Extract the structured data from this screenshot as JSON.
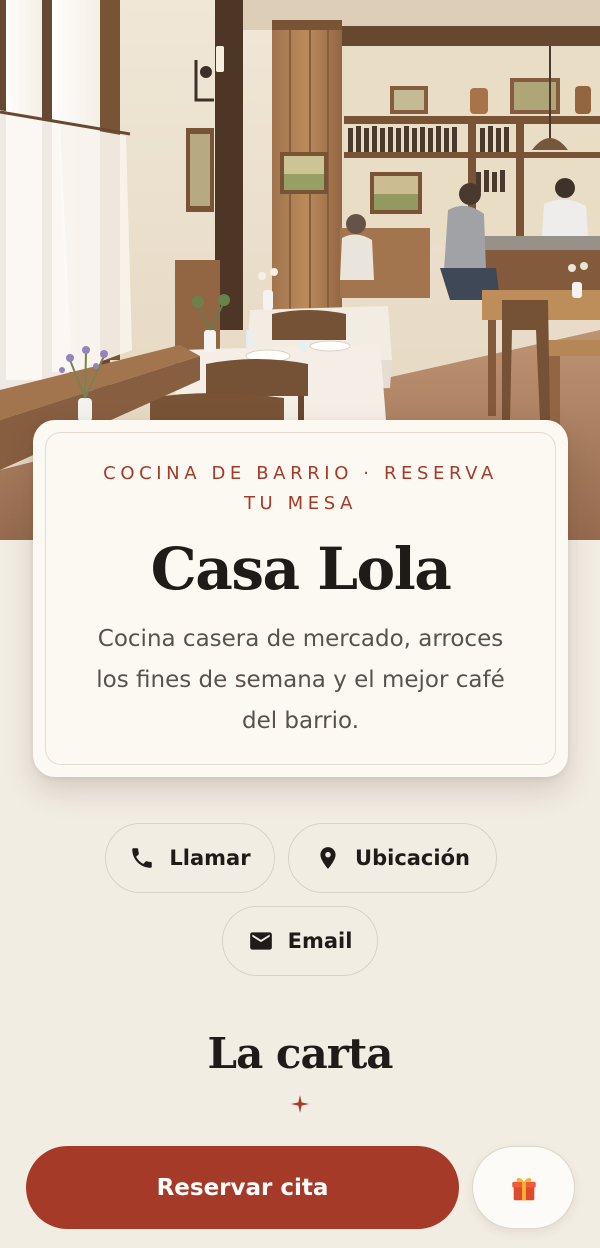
{
  "hero": {
    "image": "restaurant-interior-photo"
  },
  "intro": {
    "eyebrow": "COCINA DE BARRIO · RESERVA TU MESA",
    "title": "Casa Lola",
    "description": "Cocina casera de mercado, arroces los fines de semana y el mejor café del barrio."
  },
  "contact": {
    "call_label": "Llamar",
    "call_icon": "phone-icon",
    "location_label": "Ubicación",
    "location_icon": "location-pin-icon",
    "email_label": "Email",
    "email_icon": "mail-icon"
  },
  "menu_section": {
    "title": "La carta",
    "ornament_icon": "sparkle-icon"
  },
  "actions": {
    "reserve_label": "Reservar cita",
    "gift_icon": "gift-icon"
  },
  "colors": {
    "accent": "#a63a28",
    "background": "#f2ede3",
    "card": "#fcf9f3",
    "ink": "#1f1b18"
  }
}
